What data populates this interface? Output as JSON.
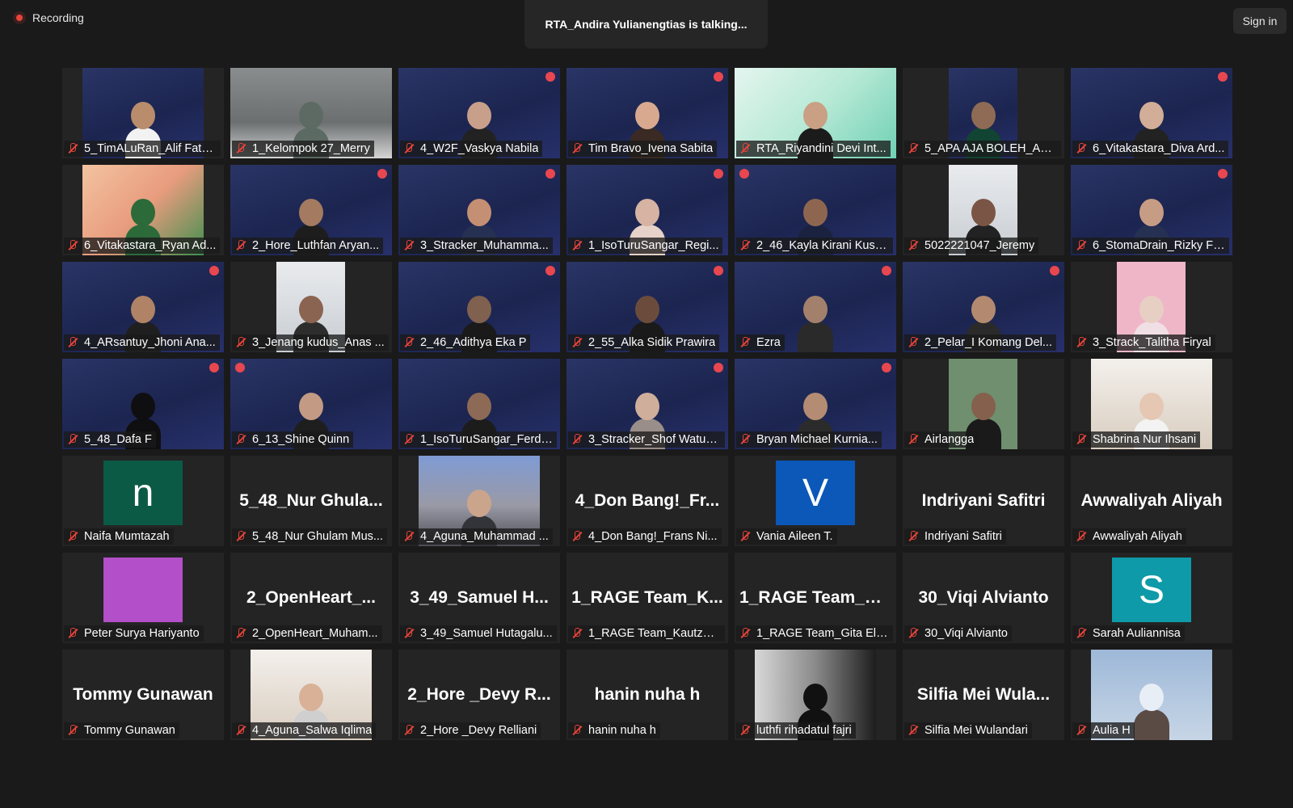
{
  "recording": {
    "label": "Recording"
  },
  "talking_banner": "RTA_Andira Yulianengtias is talking...",
  "sign_in": "Sign in",
  "tiles": [
    {
      "label": "5_TimALuRan_Alif Fatu...",
      "type": "video",
      "frame": "half",
      "bg": "space",
      "skin": "#b98c6c",
      "shirt": "#f2f2f2"
    },
    {
      "label": "1_Kelompok 27_Merry",
      "type": "video",
      "frame": "full",
      "bg": "room",
      "skin": "#5c6a63",
      "shirt": "#5b6a62"
    },
    {
      "label": "4_W2F_Vaskya Nabila",
      "type": "video",
      "frame": "full",
      "bg": "space",
      "skin": "#c89f8a",
      "shirt": "#222222",
      "badge": "r"
    },
    {
      "label": "Tim Bravo_Ivena Sabita",
      "type": "video",
      "frame": "full",
      "bg": "space",
      "skin": "#d8a98f",
      "shirt": "#3a2a23",
      "badge": "r"
    },
    {
      "label": "RTA_Riyandini Devi Int...",
      "type": "video",
      "frame": "full",
      "bg": "final",
      "skin": "#c9a083",
      "shirt": "#1b1b1b"
    },
    {
      "label": "5_APA AJA BOLEH_Adi...",
      "type": "video",
      "frame": "narrow",
      "bg": "space",
      "skin": "#8f6a54",
      "shirt": "#114433"
    },
    {
      "label": "6_Vitakastara_Diva Ard...",
      "type": "video",
      "frame": "full",
      "bg": "space",
      "skin": "#d2ad97",
      "shirt": "#222222",
      "badge": "r"
    },
    {
      "label": "6_Vitakastara_Ryan Ad...",
      "type": "video",
      "frame": "half",
      "bg": "map",
      "skin": "#2c6a3a",
      "shirt": "#2c6a3a"
    },
    {
      "label": "2_Hore_Luthfan Aryan...",
      "type": "video",
      "frame": "full",
      "bg": "space",
      "skin": "#a47a60",
      "shirt": "#1d1d1d",
      "badge": "r"
    },
    {
      "label": "3_Stracker_Muhamma...",
      "type": "video",
      "frame": "full",
      "bg": "space",
      "skin": "#c48f73",
      "shirt": "#263052",
      "badge": "r"
    },
    {
      "label": "1_IsoTuruSangar_Regi...",
      "type": "video",
      "frame": "full",
      "bg": "space",
      "skin": "#d6b3a2",
      "shirt": "#e6d2c8",
      "badge": "r"
    },
    {
      "label": "2_46_Kayla Kirani Kusn...",
      "type": "video",
      "frame": "full",
      "bg": "space",
      "skin": "#8e6650",
      "shirt": "#1a2240",
      "badge": "l"
    },
    {
      "label": "5022221047_Jeremy",
      "type": "video",
      "frame": "narrow",
      "bg": "light",
      "skin": "#7a5545",
      "shirt": "#222222"
    },
    {
      "label": "6_StomaDrain_Rizky Fa...",
      "type": "video",
      "frame": "full",
      "bg": "space",
      "skin": "#c79c85",
      "shirt": "#263052",
      "badge": "r"
    },
    {
      "label": "4_ARsantuy_Jhoni Ana...",
      "type": "video",
      "frame": "full",
      "bg": "space",
      "skin": "#b08266",
      "shirt": "#1f1f1f",
      "badge": "r"
    },
    {
      "label": "3_Jenang kudus_Anas ...",
      "type": "video",
      "frame": "narrow",
      "bg": "light",
      "skin": "#8a6450",
      "shirt": "#2d2d2d"
    },
    {
      "label": "2_46_Adithya Eka P",
      "type": "video",
      "frame": "full",
      "bg": "space",
      "skin": "#80604e",
      "shirt": "#1a1a1a",
      "badge": "r"
    },
    {
      "label": "2_55_Alka Sidik Prawira",
      "type": "video",
      "frame": "full",
      "bg": "space",
      "skin": "#6b4c3c",
      "shirt": "#1a1a1a",
      "badge": "r"
    },
    {
      "label": "Ezra",
      "type": "video",
      "frame": "full",
      "bg": "space",
      "skin": "#a3806c",
      "shirt": "#2a2a2a",
      "badge": "r"
    },
    {
      "label": "2_Pelar_I Komang Del...",
      "type": "video",
      "frame": "full",
      "bg": "space",
      "skin": "#b38a70",
      "shirt": "#2a2a2a",
      "badge": "r"
    },
    {
      "label": "3_Strack_Talitha Firyal",
      "type": "video",
      "frame": "narrow",
      "bg": "pink",
      "skin": "#e8cfc4",
      "shirt": "#f0e0e6"
    },
    {
      "label": "5_48_Dafa F",
      "type": "video",
      "frame": "full",
      "bg": "space",
      "skin": "#0f0f12",
      "shirt": "#0f0f12",
      "badge": "r"
    },
    {
      "label": "6_13_Shine Quinn",
      "type": "video",
      "frame": "full",
      "bg": "space",
      "skin": "#c39a84",
      "shirt": "#1e1e1e",
      "badge": "l"
    },
    {
      "label": "1_IsoTuruSangar_Ferdi...",
      "type": "video",
      "frame": "full",
      "bg": "space",
      "skin": "#8d6a55",
      "shirt": "#1c1c1c"
    },
    {
      "label": "3_Stracker_Shof Watun...",
      "type": "video",
      "frame": "full",
      "bg": "space",
      "skin": "#cfae9c",
      "shirt": "#9a8e8a",
      "badge": "r"
    },
    {
      "label": "Bryan Michael Kurnia...",
      "type": "video",
      "frame": "full",
      "bg": "space",
      "skin": "#b48c74",
      "shirt": "#2b2b2b",
      "badge": "r"
    },
    {
      "label": "Airlangga",
      "type": "video",
      "frame": "narrow",
      "bg": "green",
      "skin": "#85604c",
      "shirt": "#1a1a1a"
    },
    {
      "label": "Shabrina Nur Ihsani",
      "type": "video",
      "frame": "half",
      "bg": "selfie",
      "skin": "#e6c7b3",
      "shirt": "#f3f3f3"
    },
    {
      "label": "Naifa Mumtazah",
      "type": "avatar",
      "letter": "n",
      "color": "#0b5a45"
    },
    {
      "label": "5_48_Nur Ghulam Mus...",
      "type": "name",
      "display": "5_48_Nur  Ghula..."
    },
    {
      "label": "4_Aguna_Muhammad ...",
      "type": "video",
      "frame": "half",
      "bg": "crowd",
      "skin": "#caa58c",
      "shirt": "#33333a"
    },
    {
      "label": "4_Don Bang!_Frans Ni...",
      "type": "name",
      "display": "4_Don  Bang!_Fr..."
    },
    {
      "label": "Vania Aileen T.",
      "type": "avatar",
      "letter": "V",
      "color": "#0b58b8"
    },
    {
      "label": "Indriyani Safitri",
      "type": "name",
      "display": "Indriyani Safitri"
    },
    {
      "label": "Awwaliyah Aliyah",
      "type": "name",
      "display": "Awwaliyah Aliyah"
    },
    {
      "label": "Peter Surya Hariyanto",
      "type": "avatar",
      "letter": "",
      "color": "#b34fc8"
    },
    {
      "label": "2_OpenHeart_Muham...",
      "type": "name",
      "display": "2_OpenHeart_..."
    },
    {
      "label": "3_49_Samuel Hutagalu...",
      "type": "name",
      "display": "3_49_Samuel  H..."
    },
    {
      "label": "1_RAGE Team_Kautzar ...",
      "type": "name",
      "display": "1_RAGE  Team_K..."
    },
    {
      "label": "1_RAGE Team_Gita Eliz...",
      "type": "name",
      "display": "1_RAGE  Team_G..."
    },
    {
      "label": "30_Viqi Alvianto",
      "type": "name",
      "display": "30_Viqi Alvianto"
    },
    {
      "label": "Sarah Auliannisa",
      "type": "avatar",
      "letter": "S",
      "color": "#0e9aa8"
    },
    {
      "label": "Tommy Gunawan",
      "type": "name",
      "display": "Tommy Gunawan"
    },
    {
      "label": "4_Aguna_Salwa Iqlima",
      "type": "video",
      "frame": "half",
      "bg": "selfie",
      "skin": "#d8b197",
      "shirt": "#cfcfcf"
    },
    {
      "label": "2_Hore _Devy Relliani",
      "type": "name",
      "display": "2_Hore  _Devy  R..."
    },
    {
      "label": "hanin nuha h",
      "type": "name",
      "display": "hanin nuha h"
    },
    {
      "label": "luthfi rihadatul fajri",
      "type": "video",
      "frame": "half",
      "bg": "bw",
      "skin": "#111111",
      "shirt": "#111111"
    },
    {
      "label": "Silfia Mei Wulandari",
      "type": "name",
      "display": "Silfia Mei Wula..."
    },
    {
      "label": "Aulia H",
      "type": "video",
      "frame": "half",
      "bg": "sky",
      "skin": "#e8eef5",
      "shirt": "#5a4b45"
    }
  ]
}
